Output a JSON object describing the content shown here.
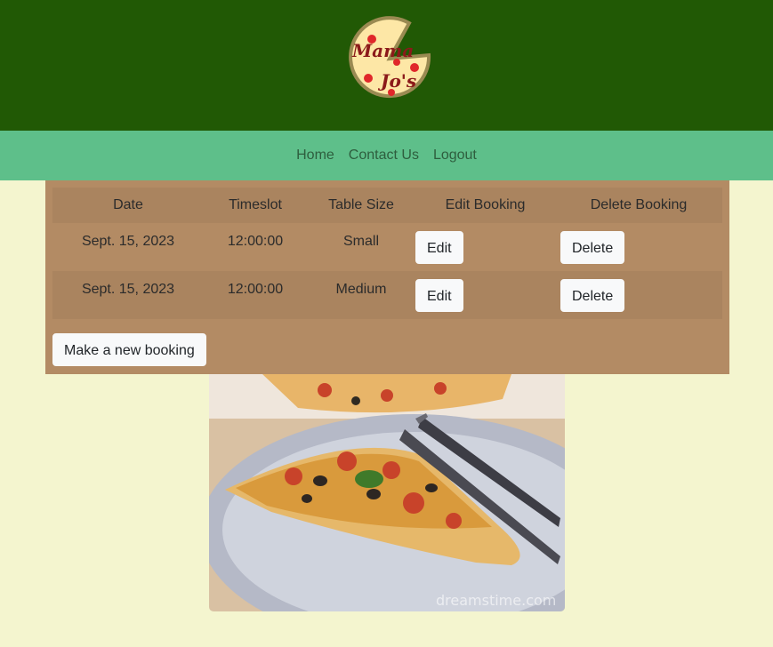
{
  "logo": {
    "line1": "Mama",
    "line2": "Jo's"
  },
  "nav": {
    "home": "Home",
    "contact": "Contact Us",
    "logout": "Logout"
  },
  "table": {
    "headers": [
      "Date",
      "Timeslot",
      "Table Size",
      "Edit Booking",
      "Delete Booking"
    ],
    "rows": [
      {
        "date": "Sept. 15, 2023",
        "timeslot": "12:00:00",
        "size": "Small",
        "edit": "Edit",
        "delete": "Delete"
      },
      {
        "date": "Sept. 15, 2023",
        "timeslot": "12:00:00",
        "size": "Medium",
        "edit": "Edit",
        "delete": "Delete"
      }
    ]
  },
  "new_booking_label": "Make a new booking",
  "photo": {
    "watermark": "dreamstime.com"
  },
  "colors": {
    "header": "#215905",
    "nav": "#5ebf8a",
    "page": "#f4f5cf",
    "panel": "#b38b64"
  }
}
